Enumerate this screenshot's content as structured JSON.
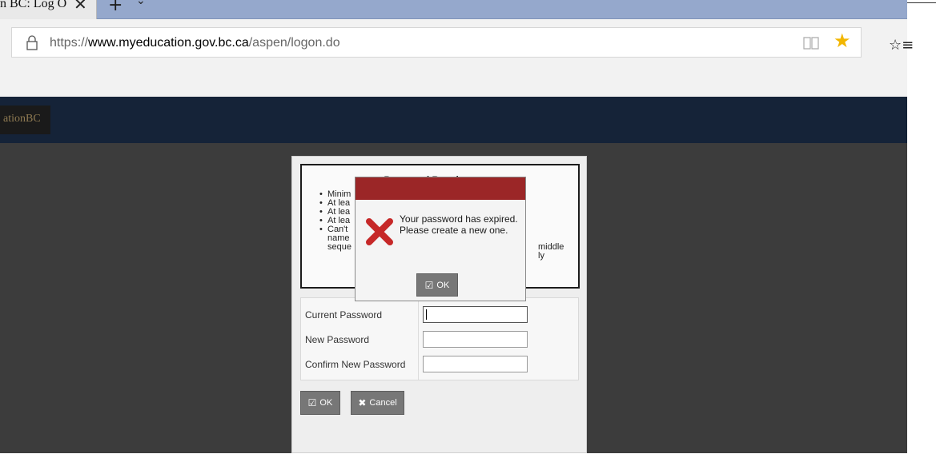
{
  "browser": {
    "tab": {
      "title": "n BC: Log O",
      "close_glyph": "✕",
      "new_tab_glyph": "+",
      "dropdown_glyph": "⌄"
    },
    "address": {
      "url_prefix": "https://",
      "url_domain": "www.myeducation.gov.bc.ca",
      "url_path": "/aspen/logon.do"
    },
    "icons": {
      "lock": "lock-icon",
      "reading_view": "reading-view-icon",
      "favorite": "star-icon",
      "favorites_hub": "favorites-hub-icon"
    },
    "star_glyph": "★",
    "hub_glyph": "☆≡"
  },
  "site": {
    "logo_text": "ationBC"
  },
  "requirements": {
    "title": "Password Requirements",
    "items": [
      "Minim",
      "At lea",
      "At lea",
      "At lea",
      "Can't"
    ],
    "continuation": [
      "name",
      "seque"
    ],
    "right_fragments": [
      "middle",
      "ly"
    ]
  },
  "form": {
    "fields": [
      {
        "label": "Current Password",
        "value": ""
      },
      {
        "label": "New Password",
        "value": ""
      },
      {
        "label": "Confirm New Password",
        "value": ""
      }
    ],
    "ok_label": "OK",
    "cancel_label": "Cancel"
  },
  "modal": {
    "message": "Your password has expired. Please create a new one.",
    "ok_label": "OK"
  },
  "colors": {
    "modal_header": "#9b2627",
    "error_x": "#c62828",
    "star": "#f2b600",
    "site_header": "#152338",
    "tab_strip": "#95a8cc"
  }
}
